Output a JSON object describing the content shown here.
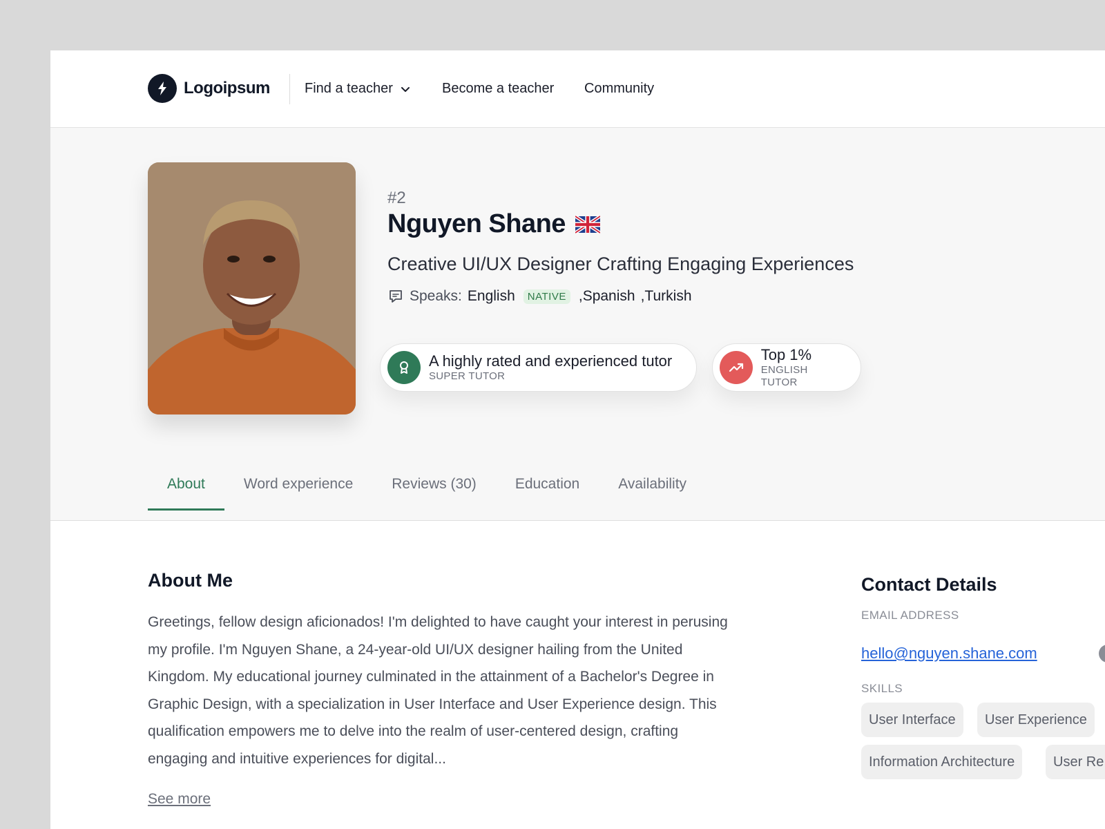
{
  "nav": {
    "logo_text": "Logoipsum",
    "items": [
      {
        "label": "Find a teacher",
        "has_dropdown": true
      },
      {
        "label": "Become a teacher"
      },
      {
        "label": "Community"
      }
    ]
  },
  "profile": {
    "rank": "#2",
    "name": "Nguyen Shane",
    "flag_icon": "uk-flag-icon",
    "headline": "Creative UI/UX Designer Crafting Engaging Experiences",
    "speaks_label": "Speaks:",
    "languages": [
      {
        "name": "English",
        "badge": "NATIVE"
      },
      {
        "name": ",Spanish"
      },
      {
        "name": ",Turkish"
      }
    ],
    "badges": [
      {
        "title": "A highly rated and experienced tutor",
        "subtitle": "SUPER TUTOR",
        "icon": "award-ribbon-icon",
        "color": "#2f7a58"
      },
      {
        "title": "Top 1%",
        "subtitle": "ENGLISH TUTOR",
        "icon": "trending-up-icon",
        "color": "#e35a5a"
      }
    ]
  },
  "tabs": [
    {
      "label": "About",
      "active": true
    },
    {
      "label": "Word experience"
    },
    {
      "label": "Reviews (30)"
    },
    {
      "label": "Education"
    },
    {
      "label": "Availability"
    }
  ],
  "about": {
    "title": "About Me",
    "body": "Greetings, fellow design aficionados! I'm delighted to have caught your interest in perusing my profile. I'm Nguyen Shane, a 24-year-old UI/UX designer hailing from the United Kingdom. My educational journey culminated in the attainment of a Bachelor's Degree in Graphic Design, with a specialization in User Interface and User Experience design. This qualification empowers me to delve into the realm of user-centered design, crafting engaging and intuitive experiences for digital...",
    "see_more": "See more"
  },
  "contact": {
    "title": "Contact Details",
    "email_label": "EMAIL ADDRESS",
    "email": "hello@nguyen.shane.com",
    "skills_label": "SKILLS",
    "skills": [
      "User Interface",
      "User Experience",
      "Information Architecture",
      "User Re"
    ]
  }
}
